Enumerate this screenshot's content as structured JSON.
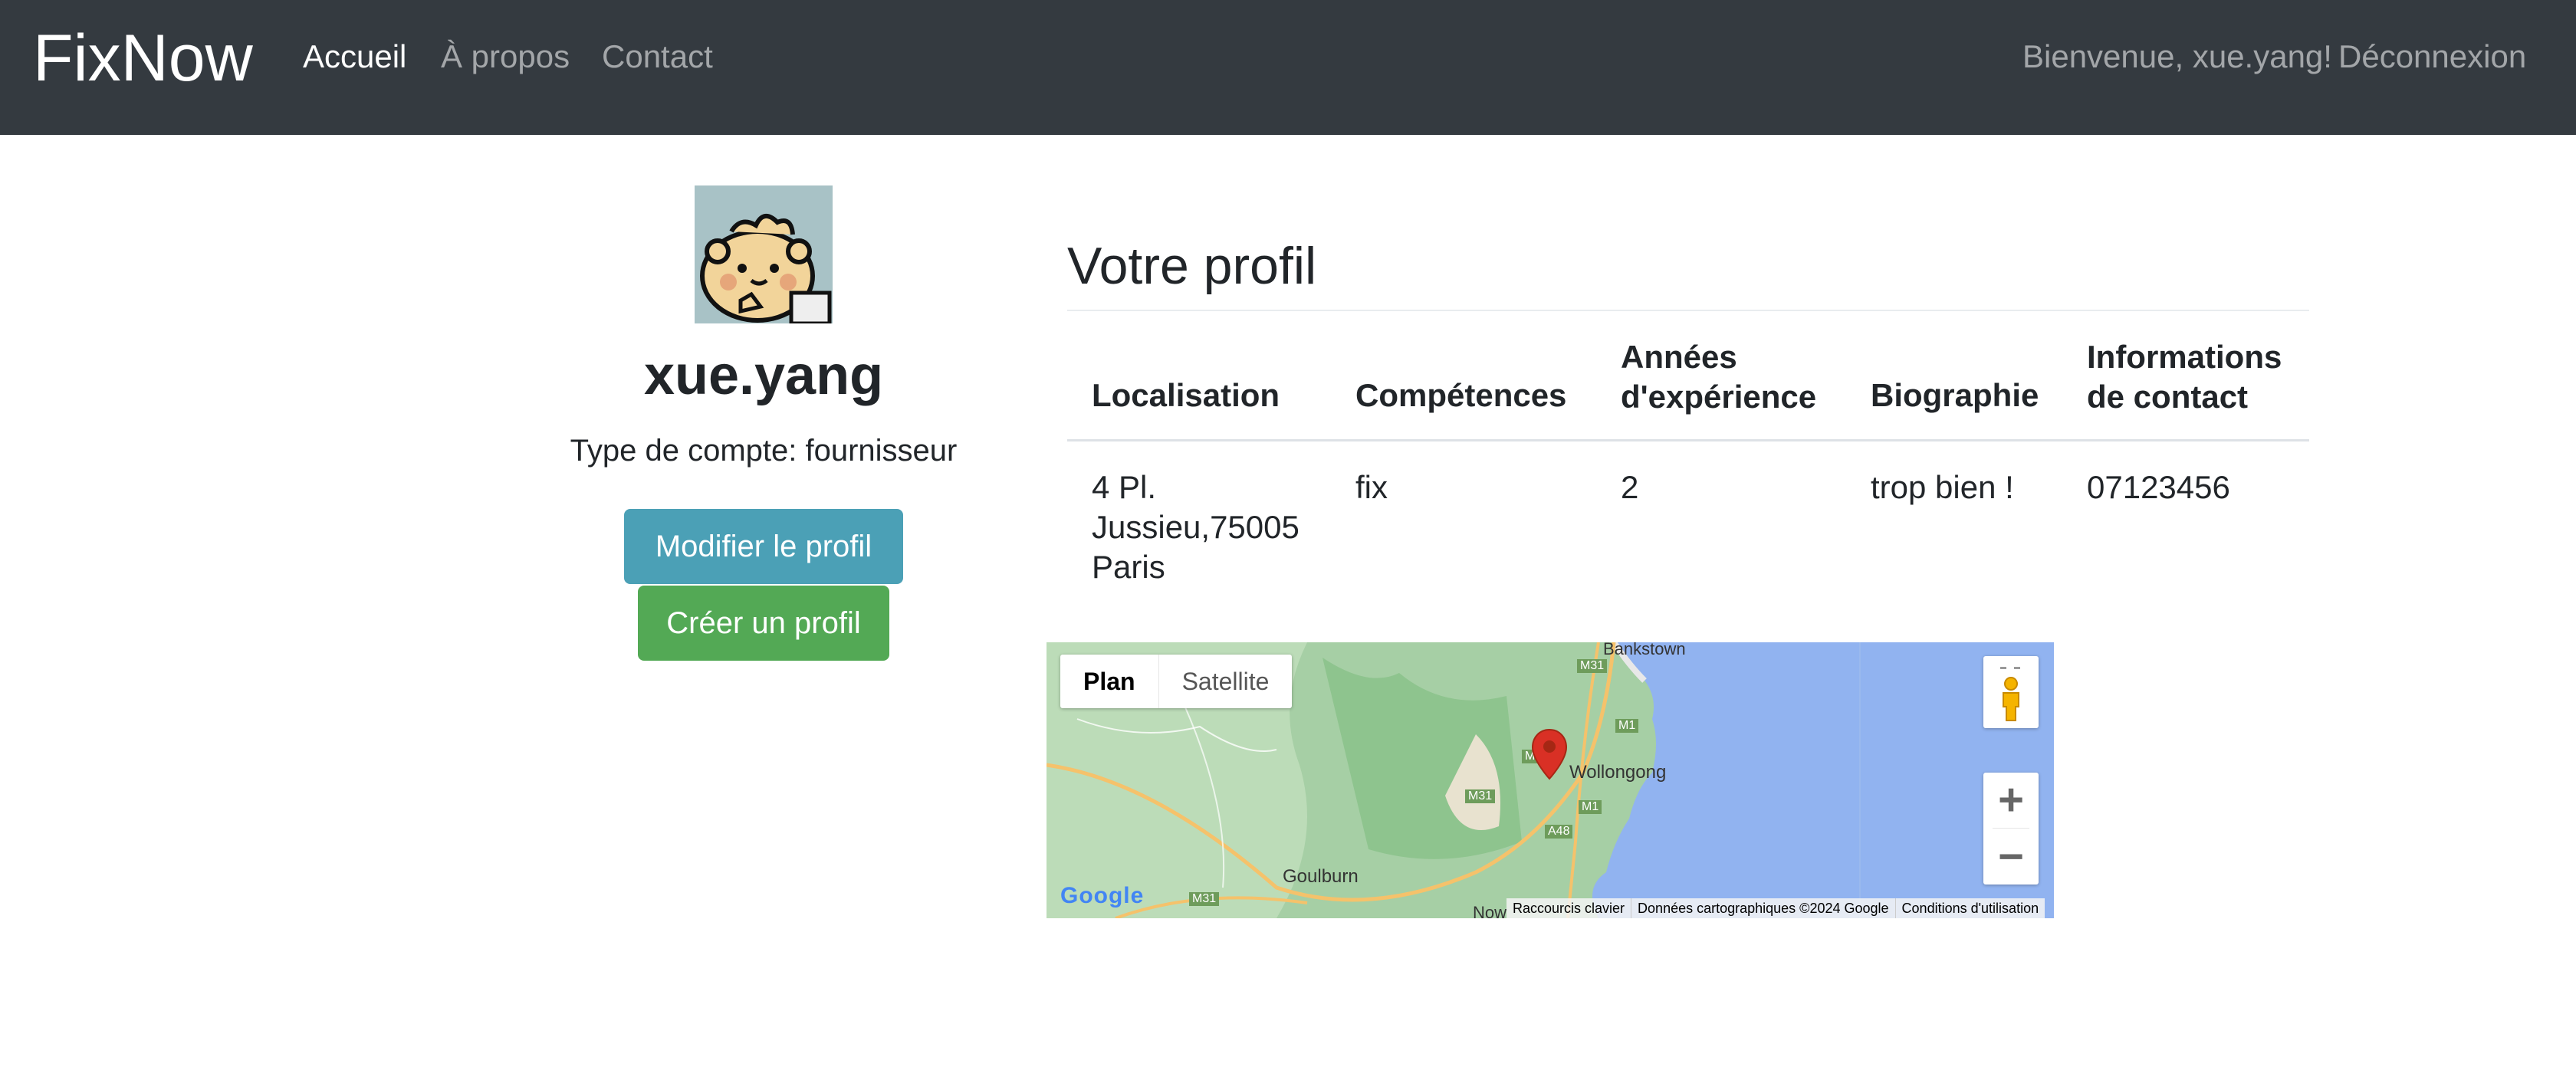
{
  "navbar": {
    "brand": "FixNow",
    "links": {
      "home": "Accueil",
      "about": "À propos",
      "contact": "Contact"
    },
    "welcome": "Bienvenue, xue.yang!",
    "logout": "Déconnexion"
  },
  "profile": {
    "username": "xue.yang",
    "account_type": "Type de compte: fournisseur",
    "edit_button": "Modifier le profil",
    "create_button": "Créer un profil"
  },
  "details": {
    "title": "Votre profil",
    "headers": [
      "Localisation",
      "Compétences",
      "Années d'expérience",
      "Biographie",
      "Informations de contact"
    ],
    "row": [
      "4 Pl. Jussieu,75005 Paris",
      "fix",
      "2",
      "trop bien !",
      "07123456"
    ]
  },
  "map": {
    "type_buttons": {
      "map": "Plan",
      "satellite": "Satellite"
    },
    "zoom_in": "+",
    "zoom_out": "−",
    "places": {
      "bankstown": "Bankstown",
      "wollongong": "Wollongong",
      "goulburn": "Goulburn",
      "nowra": "Now"
    },
    "roads": {
      "m31a": "M31",
      "m31b": "M31",
      "m31c": "M31",
      "m1a": "M1",
      "m1b": "M1",
      "a48": "A48",
      "m3": "M3"
    },
    "logo": "Google",
    "attribution": [
      "Raccourcis clavier",
      "Données cartographiques ©2024 Google",
      "Conditions d'utilisation"
    ]
  },
  "colors": {
    "navbar_bg": "#343a40",
    "edit_button": "#4ba0b6",
    "create_button": "#53a955",
    "marker": "#d93025",
    "ocean": "#91b3f0"
  }
}
